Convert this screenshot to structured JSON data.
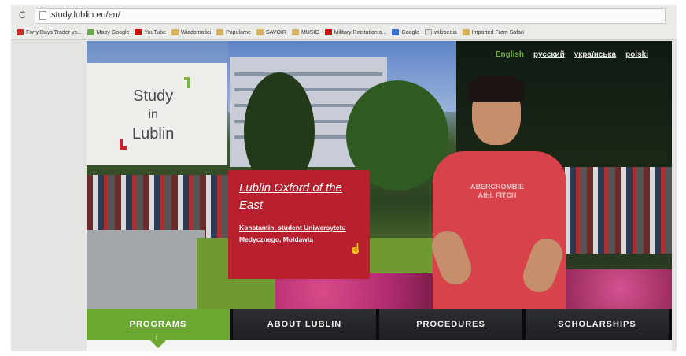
{
  "browser": {
    "url": "study.lublin.eu/en/",
    "reload_glyph": "C",
    "bookmarks": [
      {
        "label": "Forty Days Trader vs...",
        "icon": "red"
      },
      {
        "label": "Mapy Google",
        "icon": "maps"
      },
      {
        "label": "YouTube",
        "icon": "yt"
      },
      {
        "label": "Wiadomości",
        "icon": "folder"
      },
      {
        "label": "Popularne",
        "icon": "folder"
      },
      {
        "label": "SAVOIR",
        "icon": "folder"
      },
      {
        "label": "MUSIC",
        "icon": "folder"
      },
      {
        "label": "Military Recitation o...",
        "icon": "yt"
      },
      {
        "label": "Google",
        "icon": "blue"
      },
      {
        "label": "wikipedia",
        "icon": "wiki"
      },
      {
        "label": "Imported From Safari",
        "icon": "folder"
      }
    ]
  },
  "site": {
    "logo": {
      "line1": "Study",
      "line2": "in",
      "line3": "Lublin"
    },
    "languages": [
      {
        "label": "English",
        "active": true
      },
      {
        "label": "русский",
        "active": false
      },
      {
        "label": "українська",
        "active": false
      },
      {
        "label": "polski",
        "active": false
      }
    ],
    "feature": {
      "title": "Lublin Oxford of the East",
      "subtitle": "Konstantin, student Uniwersytetu Medycznego, Mołdawia"
    },
    "shirt_print": "ABERCROMBIE Athl. FITCH",
    "nav": [
      {
        "label": "PROGRAMS",
        "active": true
      },
      {
        "label": "ABOUT LUBLIN",
        "active": false
      },
      {
        "label": "PROCEDURES",
        "active": false
      },
      {
        "label": "SCHOLARSHIPS",
        "active": false
      }
    ],
    "nav_arrow": "↓"
  },
  "colors": {
    "brand_green": "#6aa832",
    "brand_red": "#b8202e",
    "nav_dark": "#1d1f22"
  }
}
